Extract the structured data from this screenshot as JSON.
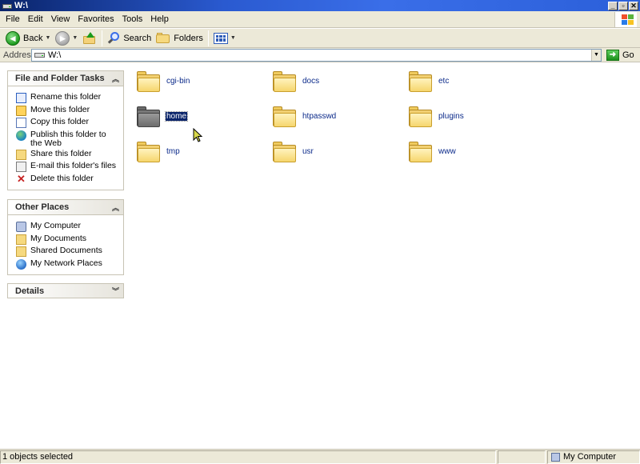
{
  "window": {
    "title": "W:\\"
  },
  "window_buttons": {
    "minimize": "_",
    "maximize": "▫",
    "close": "✕"
  },
  "menu": [
    {
      "label": "File"
    },
    {
      "label": "Edit"
    },
    {
      "label": "View"
    },
    {
      "label": "Favorites"
    },
    {
      "label": "Tools"
    },
    {
      "label": "Help"
    }
  ],
  "toolbar": {
    "back_label": "Back",
    "search_label": "Search",
    "folders_label": "Folders"
  },
  "address": {
    "label": "Address",
    "value": "W:\\",
    "go_label": "Go"
  },
  "tasks_panel": {
    "title": "File and Folder Tasks",
    "items": [
      {
        "label": "Rename this folder",
        "icon": "rename-icon"
      },
      {
        "label": "Move this folder",
        "icon": "move-icon"
      },
      {
        "label": "Copy this folder",
        "icon": "copy-icon"
      },
      {
        "label": "Publish this folder to the Web",
        "icon": "publish-web-icon"
      },
      {
        "label": "Share this folder",
        "icon": "share-icon"
      },
      {
        "label": "E-mail this folder's files",
        "icon": "email-icon"
      },
      {
        "label": "Delete this folder",
        "icon": "delete-icon"
      }
    ]
  },
  "places_panel": {
    "title": "Other Places",
    "items": [
      {
        "label": "My Computer",
        "icon": "computer-icon"
      },
      {
        "label": "My Documents",
        "icon": "documents-icon"
      },
      {
        "label": "Shared Documents",
        "icon": "shared-documents-icon"
      },
      {
        "label": "My Network Places",
        "icon": "network-icon"
      }
    ]
  },
  "details_panel": {
    "title": "Details"
  },
  "folders": [
    {
      "name": "cgi-bin",
      "selected": false
    },
    {
      "name": "docs",
      "selected": false
    },
    {
      "name": "etc",
      "selected": false
    },
    {
      "name": "home",
      "selected": true
    },
    {
      "name": "htpasswd",
      "selected": false
    },
    {
      "name": "plugins",
      "selected": false
    },
    {
      "name": "tmp",
      "selected": false
    },
    {
      "name": "usr",
      "selected": false
    },
    {
      "name": "www",
      "selected": false
    }
  ],
  "status": {
    "left": "1 objects selected",
    "right": "My Computer"
  },
  "colors": {
    "titlebar": "#2a5ad0",
    "selection": "#0a246a",
    "folder_link": "#0b2a8a"
  }
}
